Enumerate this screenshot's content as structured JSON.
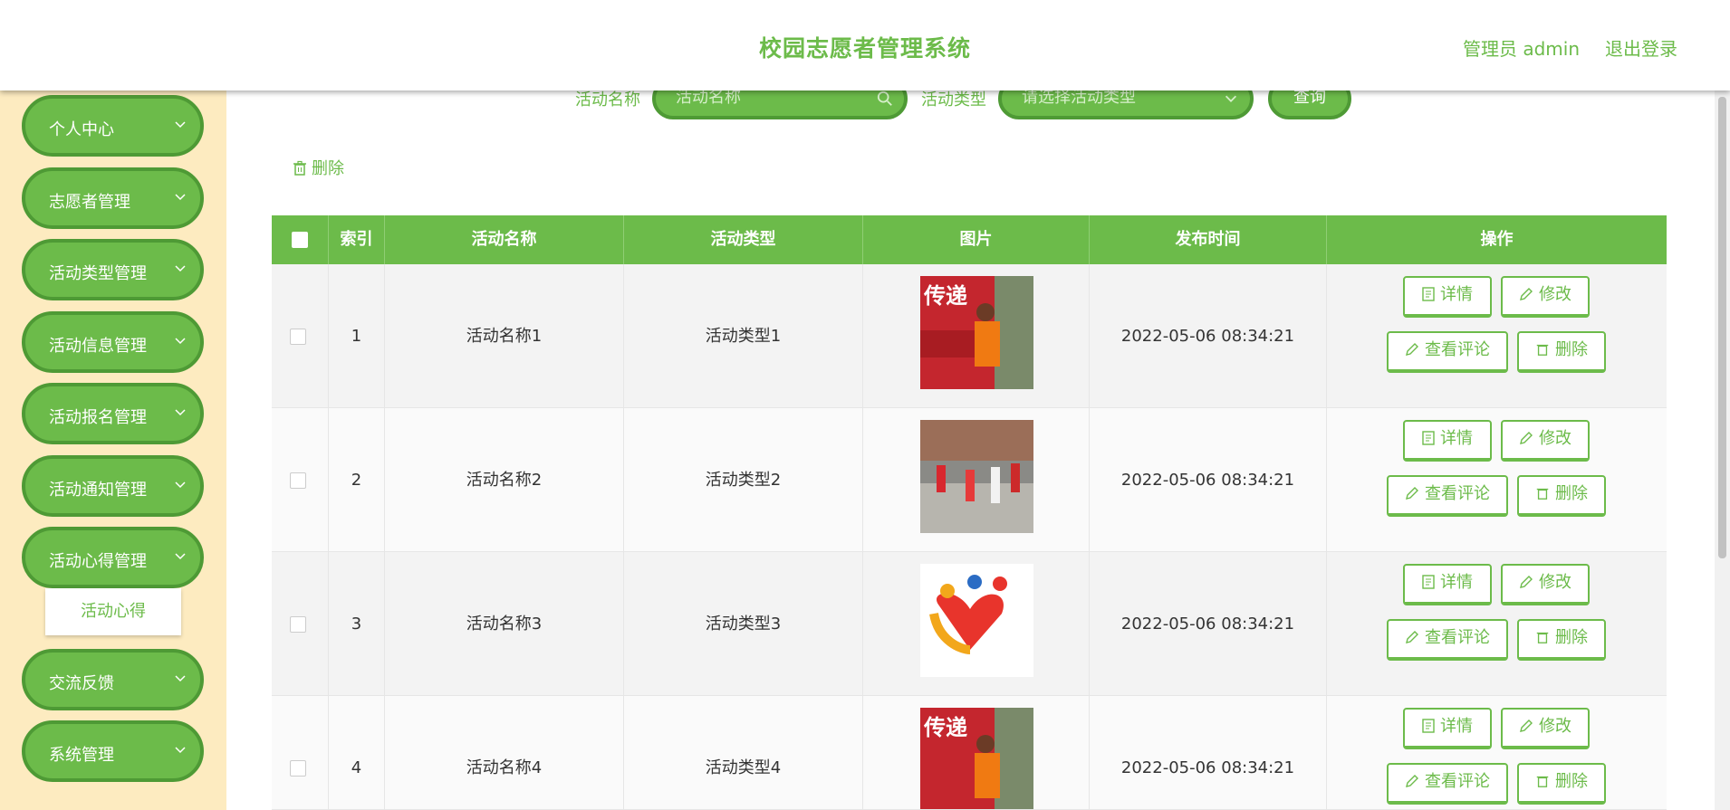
{
  "header": {
    "title": "校园志愿者管理系统",
    "user": "管理员 admin",
    "logout": "退出登录"
  },
  "sidebar": {
    "items": [
      {
        "label": "个人中心"
      },
      {
        "label": "志愿者管理"
      },
      {
        "label": "活动类型管理"
      },
      {
        "label": "活动信息管理"
      },
      {
        "label": "活动报名管理"
      },
      {
        "label": "活动通知管理"
      },
      {
        "label": "活动心得管理"
      },
      {
        "label": "交流反馈"
      },
      {
        "label": "系统管理"
      }
    ],
    "submenu": "活动心得"
  },
  "search": {
    "name_label": "活动名称",
    "name_placeholder": "活动名称",
    "type_label": "活动类型",
    "type_placeholder": "请选择活动类型",
    "button": "查询"
  },
  "toolbar": {
    "delete": "删除"
  },
  "table": {
    "headers": [
      "索引",
      "活动名称",
      "活动类型",
      "图片",
      "发布时间",
      "操作"
    ],
    "rows": [
      {
        "index": "1",
        "name": "活动名称1",
        "type": "活动类型1",
        "time": "2022-05-06 08:34:21"
      },
      {
        "index": "2",
        "name": "活动名称2",
        "type": "活动类型2",
        "time": "2022-05-06 08:34:21"
      },
      {
        "index": "3",
        "name": "活动名称3",
        "type": "活动类型3",
        "time": "2022-05-06 08:34:21"
      },
      {
        "index": "4",
        "name": "活动名称4",
        "type": "活动类型4",
        "time": "2022-05-06 08:34:21"
      }
    ],
    "actions": {
      "detail": "详情",
      "edit": "修改",
      "comments": "查看评论",
      "delete": "删除"
    }
  },
  "colors": {
    "accent": "#6cbb4a",
    "accent_dark": "#4e9a35",
    "sidebar_bg": "#fdebc0"
  }
}
